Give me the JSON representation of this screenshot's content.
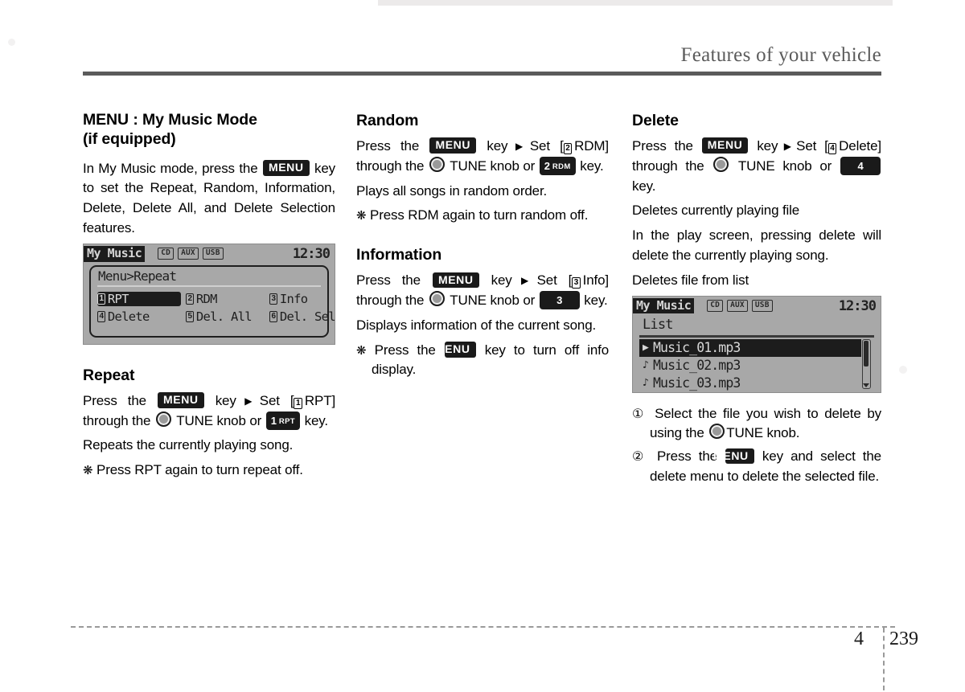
{
  "header": {
    "title": "Features of your vehicle"
  },
  "footer": {
    "chapter": "4",
    "page": "239"
  },
  "columns": {
    "left": {
      "section_title_line1": "MENU : My Music Mode",
      "section_title_line2": "(if equipped)",
      "intro_part1": "In My Music mode, press the",
      "menu_key": "MENU",
      "intro_part2": "key to set the Repeat, Random, Information, Delete, Delete All, and Delete Selection features.",
      "lcd": {
        "mode": "My Music",
        "sources": [
          "CD",
          "AUX",
          "USB"
        ],
        "clock": "12:30",
        "breadcrumb": "Menu>Repeat",
        "items": [
          {
            "num": "1",
            "label": "RPT",
            "selected": true
          },
          {
            "num": "2",
            "label": "RDM",
            "selected": false
          },
          {
            "num": "3",
            "label": "Info",
            "selected": false
          },
          {
            "num": "4",
            "label": "Delete",
            "selected": false
          },
          {
            "num": "5",
            "label": "Del. All",
            "selected": false
          },
          {
            "num": "6",
            "label": "Del. Sel",
            "selected": false
          }
        ]
      },
      "repeat": {
        "title": "Repeat",
        "press_the": "Press the",
        "menu_key": "MENU",
        "key_arrow": "key",
        "set_open": "Set [",
        "set_num": "1",
        "set_label": "RPT]",
        "through_the": "through the",
        "tune_knob": "TUNE knob or",
        "num_key_num": "1",
        "num_key_label": "RPT",
        "key_word": "key.",
        "desc": "Repeats the currently playing song.",
        "note": "Press RPT again to turn repeat off."
      }
    },
    "middle": {
      "random": {
        "title": "Random",
        "press_the": "Press the",
        "menu_key": "MENU",
        "key_arrow": "key",
        "set_open": "Set [",
        "set_num": "2",
        "set_label": "RDM]",
        "through_the": "through the",
        "tune_knob": "TUNE knob or",
        "num_key_num": "2",
        "num_key_label": "RDM",
        "key_word": "key.",
        "desc": "Plays all songs in random order.",
        "note": "Press RDM again to turn random off."
      },
      "information": {
        "title": "Information",
        "press_the": "Press the",
        "menu_key": "MENU",
        "key_arrow": "key",
        "set_open": "Set [",
        "set_num": "3",
        "set_label": "Info]",
        "through_the": "through the",
        "tune_knob": "TUNE knob or",
        "num_key_num": "3",
        "num_key_label": "",
        "key_word": "key.",
        "desc": "Displays information of the current song.",
        "note_part1": "Press the",
        "note_menu_key": "MENU",
        "note_part2": "key to turn off info display."
      }
    },
    "right": {
      "delete": {
        "title": "Delete",
        "press_the": "Press the",
        "menu_key": "MENU",
        "key_arrow": "key",
        "set_open": "Set [",
        "set_num": "4",
        "set_label": "Delete]",
        "through_the": "through the",
        "tune_knob": "TUNE knob or",
        "num_key_num": "4",
        "num_key_label": "",
        "key_word": "key.",
        "sub1": "Deletes currently playing file",
        "sub1_detail": "In the play screen, pressing delete will delete the currently playing song.",
        "sub2": "Deletes file from list"
      },
      "lcd": {
        "mode": "My Music",
        "sources": [
          "CD",
          "AUX",
          "USB"
        ],
        "clock": "12:30",
        "list_title": "List",
        "rows": [
          {
            "glyph": "▶",
            "label": "Music_01.mp3",
            "selected": true
          },
          {
            "glyph": "♪",
            "label": "Music_02.mp3",
            "selected": false
          },
          {
            "glyph": "♪",
            "label": "Music_03.mp3",
            "selected": false
          }
        ]
      },
      "steps": [
        {
          "num": "①",
          "part1": "Select the file you wish to delete by using the",
          "part2": "TUNE knob."
        },
        {
          "num": "②",
          "part1": "Press the",
          "key": "MENU",
          "part2": "key and select the delete menu to delete the selected file."
        }
      ]
    }
  },
  "glyphs": {
    "star": "❋",
    "arrow": "▶"
  },
  "colors": {
    "header_gray": "#5b5b5b",
    "lcd_bg": "#a8a8a8",
    "lcd_ink": "#1e1e1e",
    "badge_bg": "#1a1a1a"
  }
}
